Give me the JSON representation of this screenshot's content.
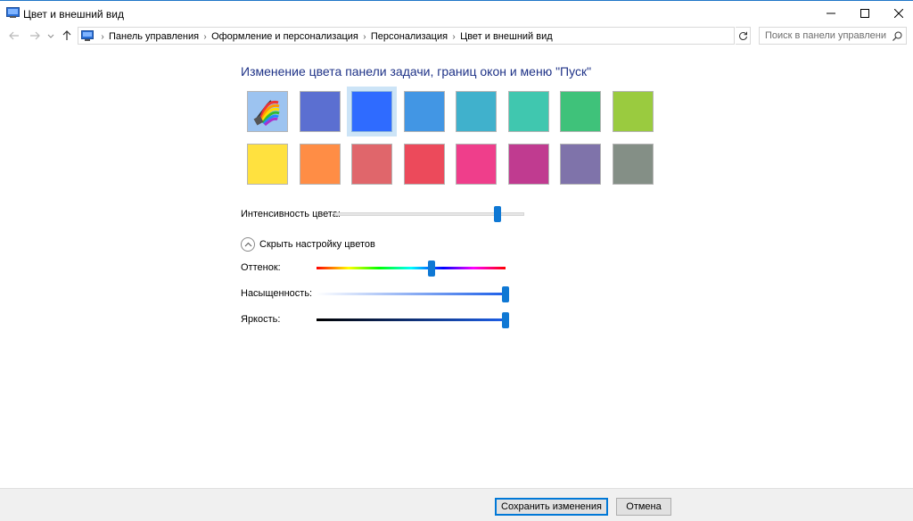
{
  "window": {
    "title": "Цвет и внешний вид",
    "accent_border": "#1f76c8"
  },
  "address": {
    "breadcrumbs": [
      "Панель управления",
      "Оформление и персонализация",
      "Персонализация",
      "Цвет и внешний вид"
    ],
    "search_placeholder": "Поиск в панели управления"
  },
  "content": {
    "heading": "Изменение цвета панели задачи, границ окон и меню \"Пуск\"",
    "swatches": [
      {
        "color": "auto",
        "icon": "color-palette-icon"
      },
      {
        "color": "#5b6fd1"
      },
      {
        "color": "#2f6bff",
        "selected": true
      },
      {
        "color": "#4296e4"
      },
      {
        "color": "#40b1cc"
      },
      {
        "color": "#40c7af"
      },
      {
        "color": "#3fc27a"
      },
      {
        "color": "#9acb3f"
      },
      {
        "color": "#ffe13f"
      },
      {
        "color": "#ff8d45"
      },
      {
        "color": "#e0666b"
      },
      {
        "color": "#ec4a5b"
      },
      {
        "color": "#ef3e8b"
      },
      {
        "color": "#c03b90"
      },
      {
        "color": "#7f73aa"
      },
      {
        "color": "#848f86"
      }
    ],
    "intensity": {
      "label": "Интенсивность цвета:",
      "value": 0.86
    },
    "toggle_label": "Скрыть настройку цветов",
    "hue": {
      "label": "Оттенок:",
      "value": 0.61
    },
    "saturation": {
      "label": "Насыщенность:",
      "value": 1.0
    },
    "brightness": {
      "label": "Яркость:",
      "value": 1.0
    }
  },
  "footer": {
    "save_label": "Сохранить изменения",
    "cancel_label": "Отмена"
  }
}
